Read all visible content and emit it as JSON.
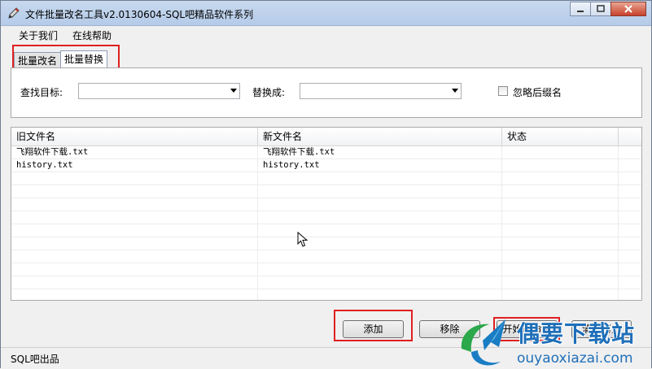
{
  "window": {
    "title": "文件批量改名工具v2.0130604-SQL吧精品软件系列"
  },
  "menu": {
    "items": [
      {
        "label": "关于我们"
      },
      {
        "label": "在线帮助"
      }
    ]
  },
  "tabs": [
    {
      "label": "批量改名",
      "active": false
    },
    {
      "label": "批量替换",
      "active": true
    }
  ],
  "search": {
    "find_label": "查找目标:",
    "find_value": "",
    "replace_label": "替换成:",
    "replace_value": "",
    "ignore_ext_label": "忽略后缀名",
    "ignore_ext_checked": false
  },
  "table": {
    "columns": [
      "旧文件名",
      "新文件名",
      "状态"
    ],
    "rows": [
      {
        "old": "飞翔软件下载.txt",
        "new": "飞翔软件下载.txt",
        "status": ""
      },
      {
        "old": "history.txt",
        "new": "history.txt",
        "status": ""
      }
    ]
  },
  "buttons": {
    "add": "添加",
    "remove": "移除",
    "start_rename": "开始重命名",
    "clear_history": "清除历史"
  },
  "status": {
    "text": "SQL吧出品"
  },
  "watermark": {
    "title": "偶要下载站",
    "url": "ouyaoxiazai.com"
  },
  "colors": {
    "highlight_box": "#e02020",
    "watermark": "#1f6fb8"
  }
}
